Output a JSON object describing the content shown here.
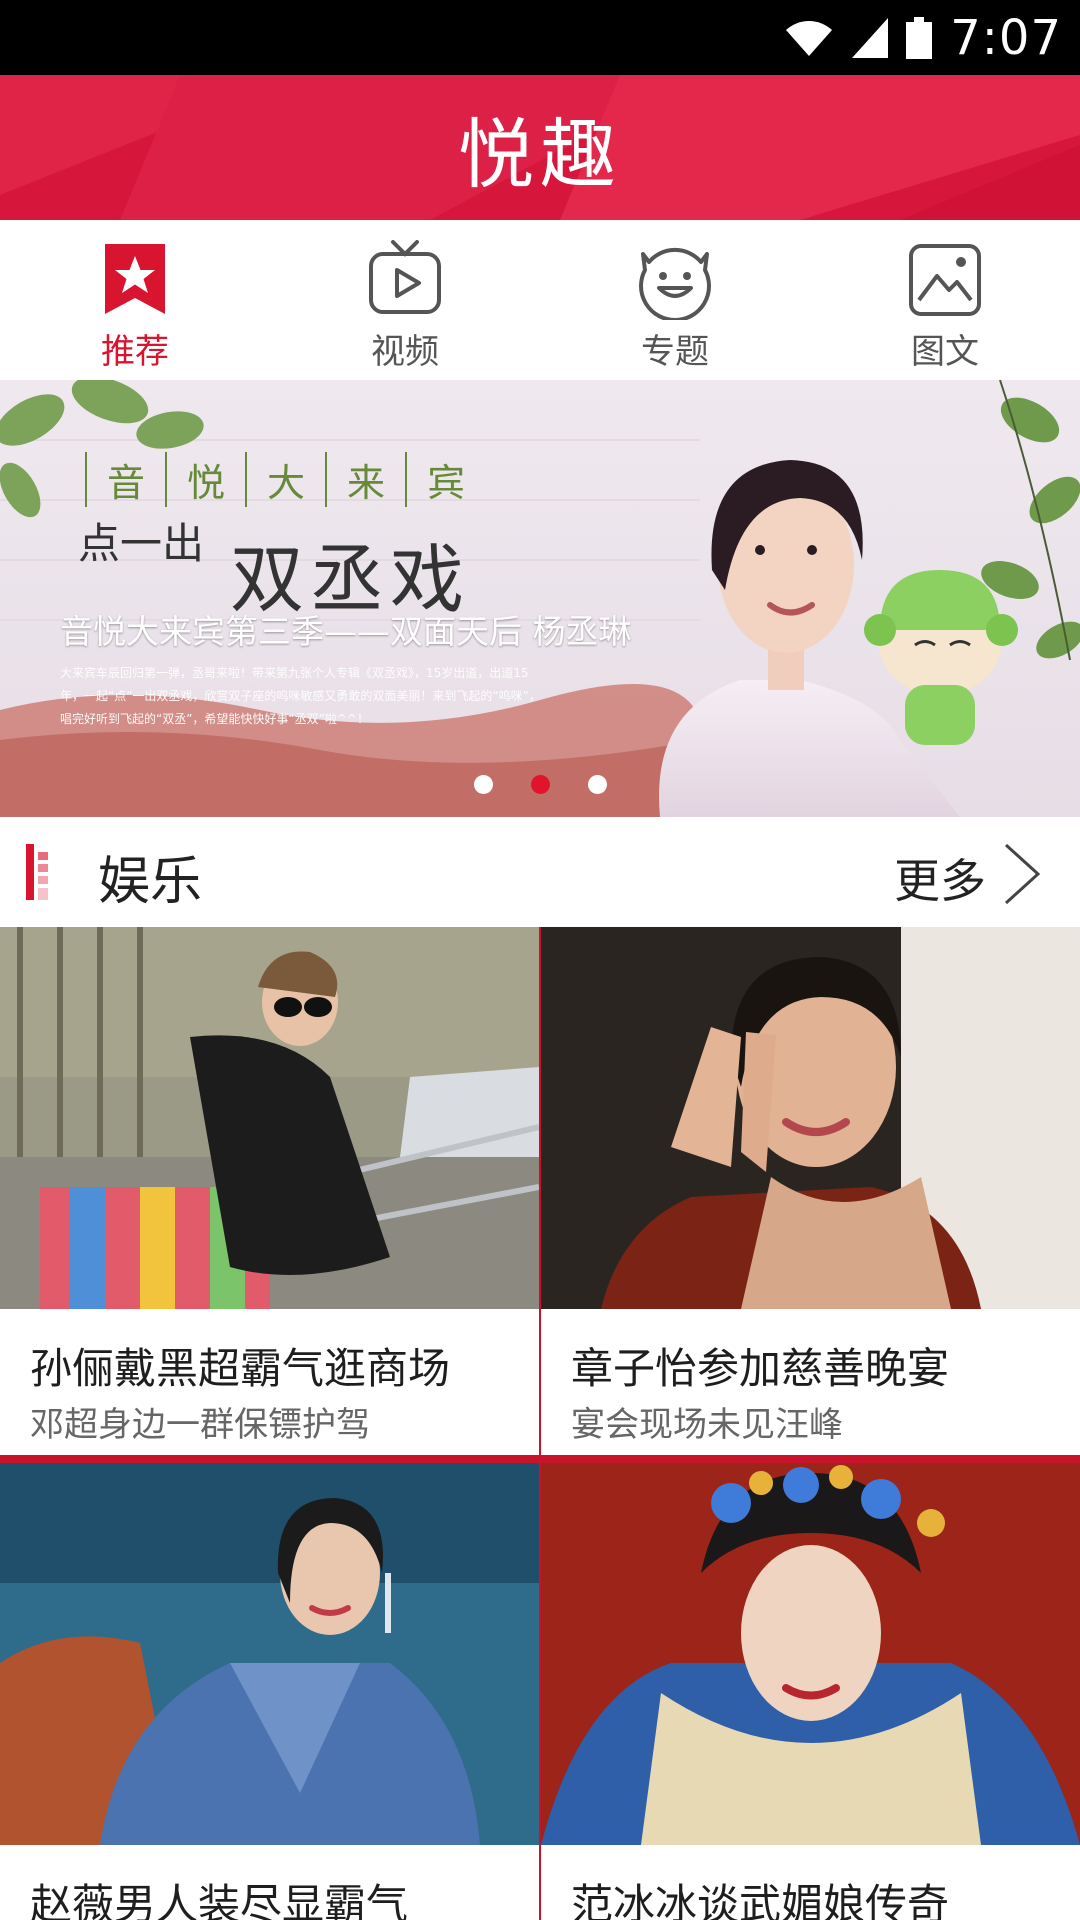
{
  "status_bar": {
    "time": "7:07"
  },
  "app": {
    "title": "悦趣"
  },
  "tabs": [
    {
      "label": "推荐",
      "active": true,
      "icon": "star-bookmark-icon"
    },
    {
      "label": "视频",
      "active": false,
      "icon": "tv-play-icon"
    },
    {
      "label": "专题",
      "active": false,
      "icon": "smiley-icon"
    },
    {
      "label": "图文",
      "active": false,
      "icon": "picture-icon"
    }
  ],
  "banner": {
    "calligraphy_row": [
      "音",
      "悦",
      "大",
      "来",
      "宾"
    ],
    "calligraphy_small": "点一出",
    "calligraphy_big": "双丞戏",
    "caption": "音悦大来宾第三季——双面天后 杨丞琳",
    "description": "大来宾车辰回归第一弹，丞哥来啦！带来第九张个人专辑《双丞戏》，15岁出道，出道15年，一起“点”一出双丞戏，欣赏双子座的呜咪敏感又勇敢的双面美丽！来到飞起的“呜咪”，唱完好听到飞起的“双丞”，希望能快快好事“丞双”啦^^！",
    "dots": 3,
    "active_dot": 1
  },
  "section": {
    "title": "娱乐",
    "more": "更多"
  },
  "colors": {
    "brand_red": "#d8142f"
  },
  "cards": [
    {
      "title": "孙俪戴黑超霸气逛商场",
      "subtitle": "邓超身边一群保镖护驾"
    },
    {
      "title": "章子怡参加慈善晚宴",
      "subtitle": "宴会现场未见汪峰"
    },
    {
      "title": "赵薇男人装尽显霸气",
      "subtitle": ""
    },
    {
      "title": "范冰冰谈武媚娘传奇",
      "subtitle": ""
    }
  ]
}
